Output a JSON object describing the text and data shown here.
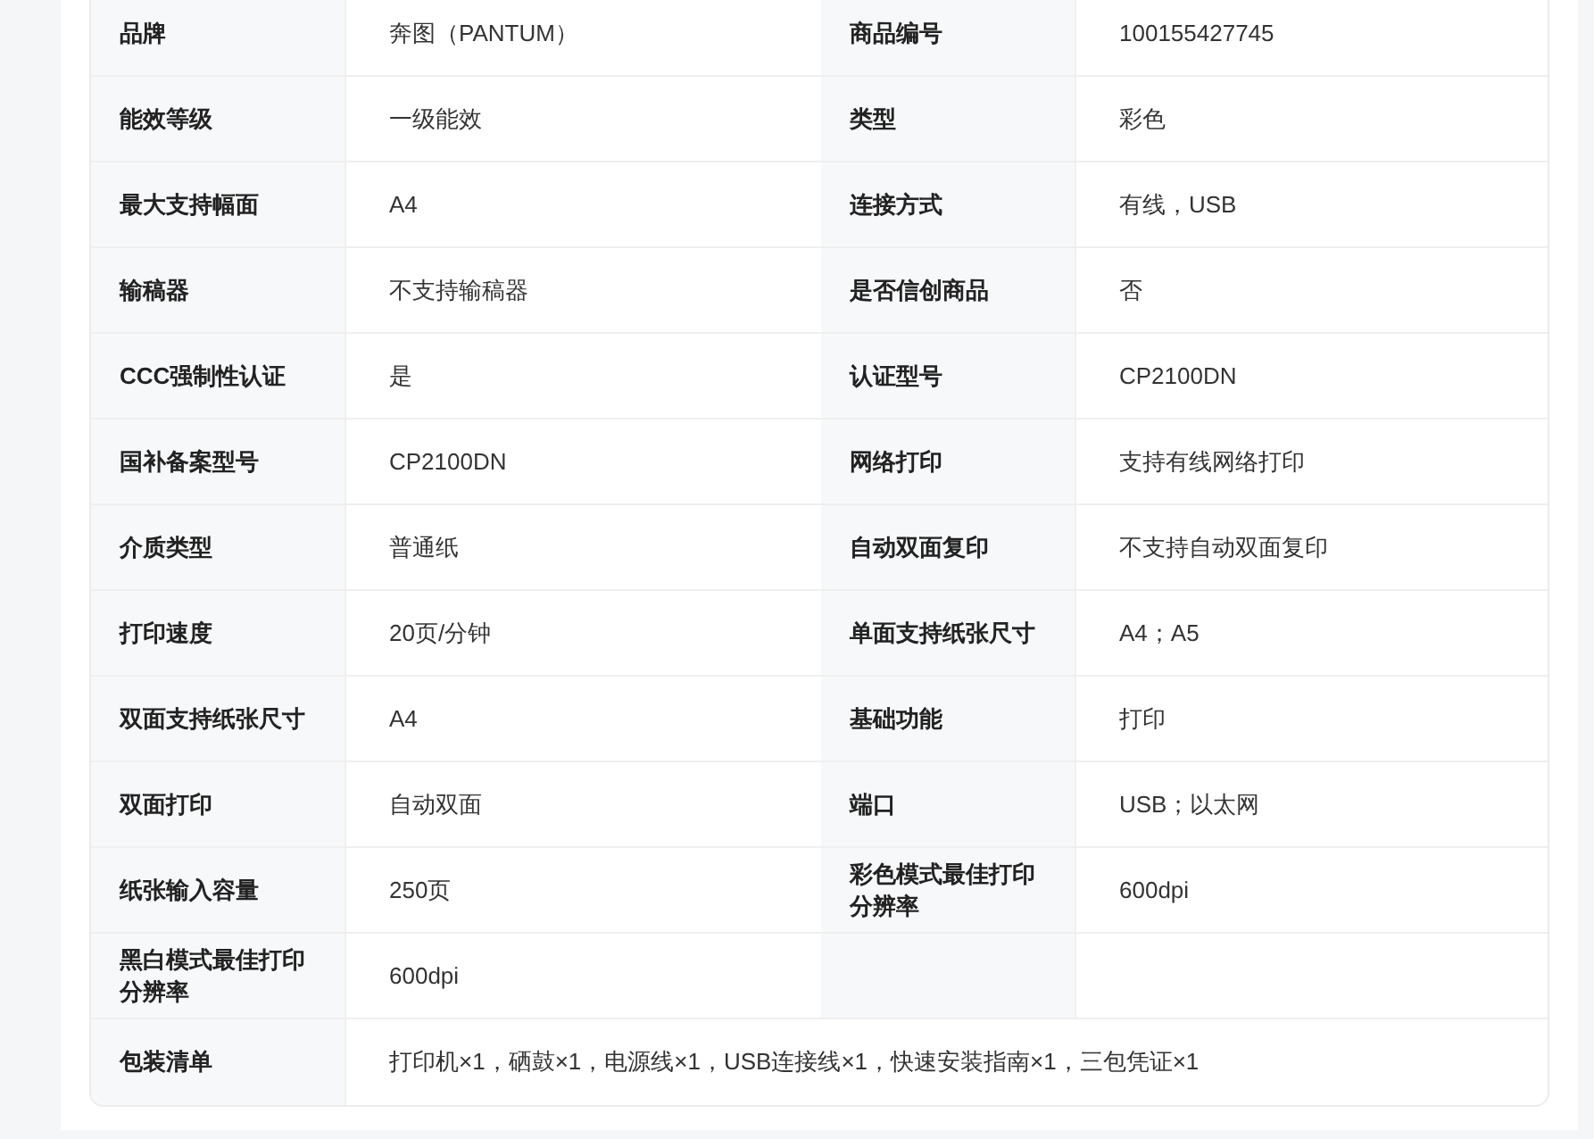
{
  "spec_table": {
    "rows": [
      {
        "kind": "pair",
        "items": [
          {
            "label": "品牌",
            "value": "奔图（PANTUM）"
          },
          {
            "label": "商品编号",
            "value": "100155427745"
          }
        ]
      },
      {
        "kind": "pair",
        "items": [
          {
            "label": "能效等级",
            "value": "一级能效"
          },
          {
            "label": "类型",
            "value": "彩色"
          }
        ]
      },
      {
        "kind": "pair",
        "items": [
          {
            "label": "最大支持幅面",
            "value": "A4"
          },
          {
            "label": "连接方式",
            "value": "有线，USB"
          }
        ]
      },
      {
        "kind": "pair",
        "items": [
          {
            "label": "输稿器",
            "value": "不支持输稿器"
          },
          {
            "label": "是否信创商品",
            "value": "否"
          }
        ]
      },
      {
        "kind": "pair",
        "items": [
          {
            "label": "CCC强制性认证",
            "value": "是"
          },
          {
            "label": "认证型号",
            "value": "CP2100DN"
          }
        ]
      },
      {
        "kind": "pair",
        "items": [
          {
            "label": "国补备案型号",
            "value": "CP2100DN"
          },
          {
            "label": "网络打印",
            "value": "支持有线网络打印"
          }
        ]
      },
      {
        "kind": "pair",
        "items": [
          {
            "label": "介质类型",
            "value": "普通纸"
          },
          {
            "label": "自动双面复印",
            "value": "不支持自动双面复印"
          }
        ]
      },
      {
        "kind": "pair",
        "items": [
          {
            "label": "打印速度",
            "value": "20页/分钟"
          },
          {
            "label": "单面支持纸张尺寸",
            "value": "A4；A5"
          }
        ]
      },
      {
        "kind": "pair",
        "items": [
          {
            "label": "双面支持纸张尺寸",
            "value": "A4"
          },
          {
            "label": "基础功能",
            "value": "打印"
          }
        ]
      },
      {
        "kind": "pair",
        "items": [
          {
            "label": "双面打印",
            "value": "自动双面"
          },
          {
            "label": "端口",
            "value": "USB；以太网"
          }
        ]
      },
      {
        "kind": "pair",
        "items": [
          {
            "label": "纸张输入容量",
            "value": "250页"
          },
          {
            "label": "彩色模式最佳打印分辨率",
            "value": "600dpi"
          }
        ]
      },
      {
        "kind": "pair",
        "items": [
          {
            "label": "黑白模式最佳打印分辨率",
            "value": "600dpi"
          }
        ]
      },
      {
        "kind": "full",
        "items": [
          {
            "label": "包装清单",
            "value": "打印机×1，硒鼓×1，电源线×1，USB连接线×1，快速安装指南×1，三包凭证×1"
          }
        ]
      }
    ]
  }
}
